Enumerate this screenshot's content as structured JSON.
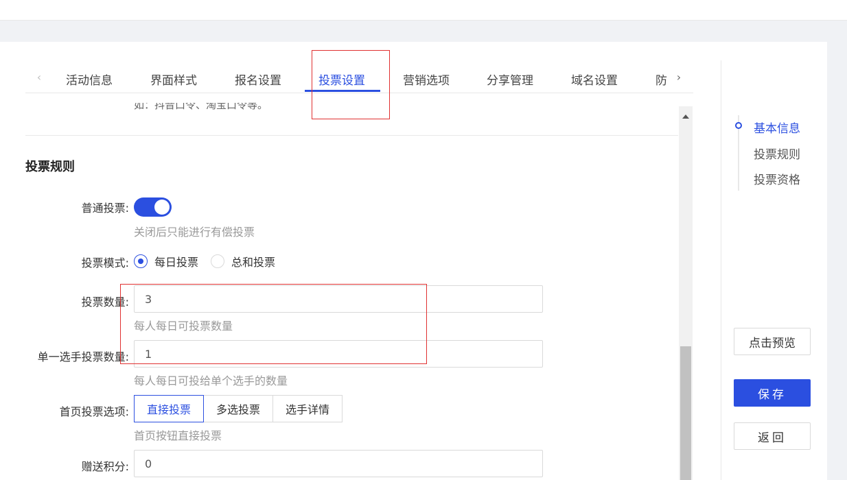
{
  "tabs": {
    "items": [
      "活动信息",
      "界面样式",
      "报名设置",
      "投票设置",
      "营销选项",
      "分享管理",
      "域名设置",
      "防"
    ],
    "active_index": 3,
    "prev_icon": "chevron-left-icon",
    "next_icon": "chevron-right-icon"
  },
  "content": {
    "cut_off_text": "如：抖音口令、淘宝口令等。",
    "section_title": "投票规则",
    "normal_vote": {
      "label": "普通投票:",
      "enabled": true,
      "hint": "关闭后只能进行有偿投票"
    },
    "vote_mode": {
      "label": "投票模式:",
      "options": [
        "每日投票",
        "总和投票"
      ],
      "selected": "每日投票"
    },
    "vote_count": {
      "label": "投票数量:",
      "value": "3",
      "hint": "每人每日可投票数量"
    },
    "single_vote_count": {
      "label": "单一选手投票数量:",
      "value": "1",
      "hint": "每人每日可投给单个选手的数量"
    },
    "home_vote_option": {
      "label": "首页投票选项:",
      "options": [
        "直接投票",
        "多选投票",
        "选手详情"
      ],
      "selected": "直接投票",
      "hint": "首页按钮直接投票"
    },
    "gift_points": {
      "label": "赠送积分:",
      "value": "0"
    }
  },
  "sidebar": {
    "anchors": [
      "基本信息",
      "投票规则",
      "投票资格"
    ],
    "active_anchor": "基本信息",
    "preview_label": "点击预览",
    "save_label": "保存",
    "back_label": "返回"
  },
  "colors": {
    "accent": "#2b4fe0",
    "highlight_box": "#e03030"
  }
}
